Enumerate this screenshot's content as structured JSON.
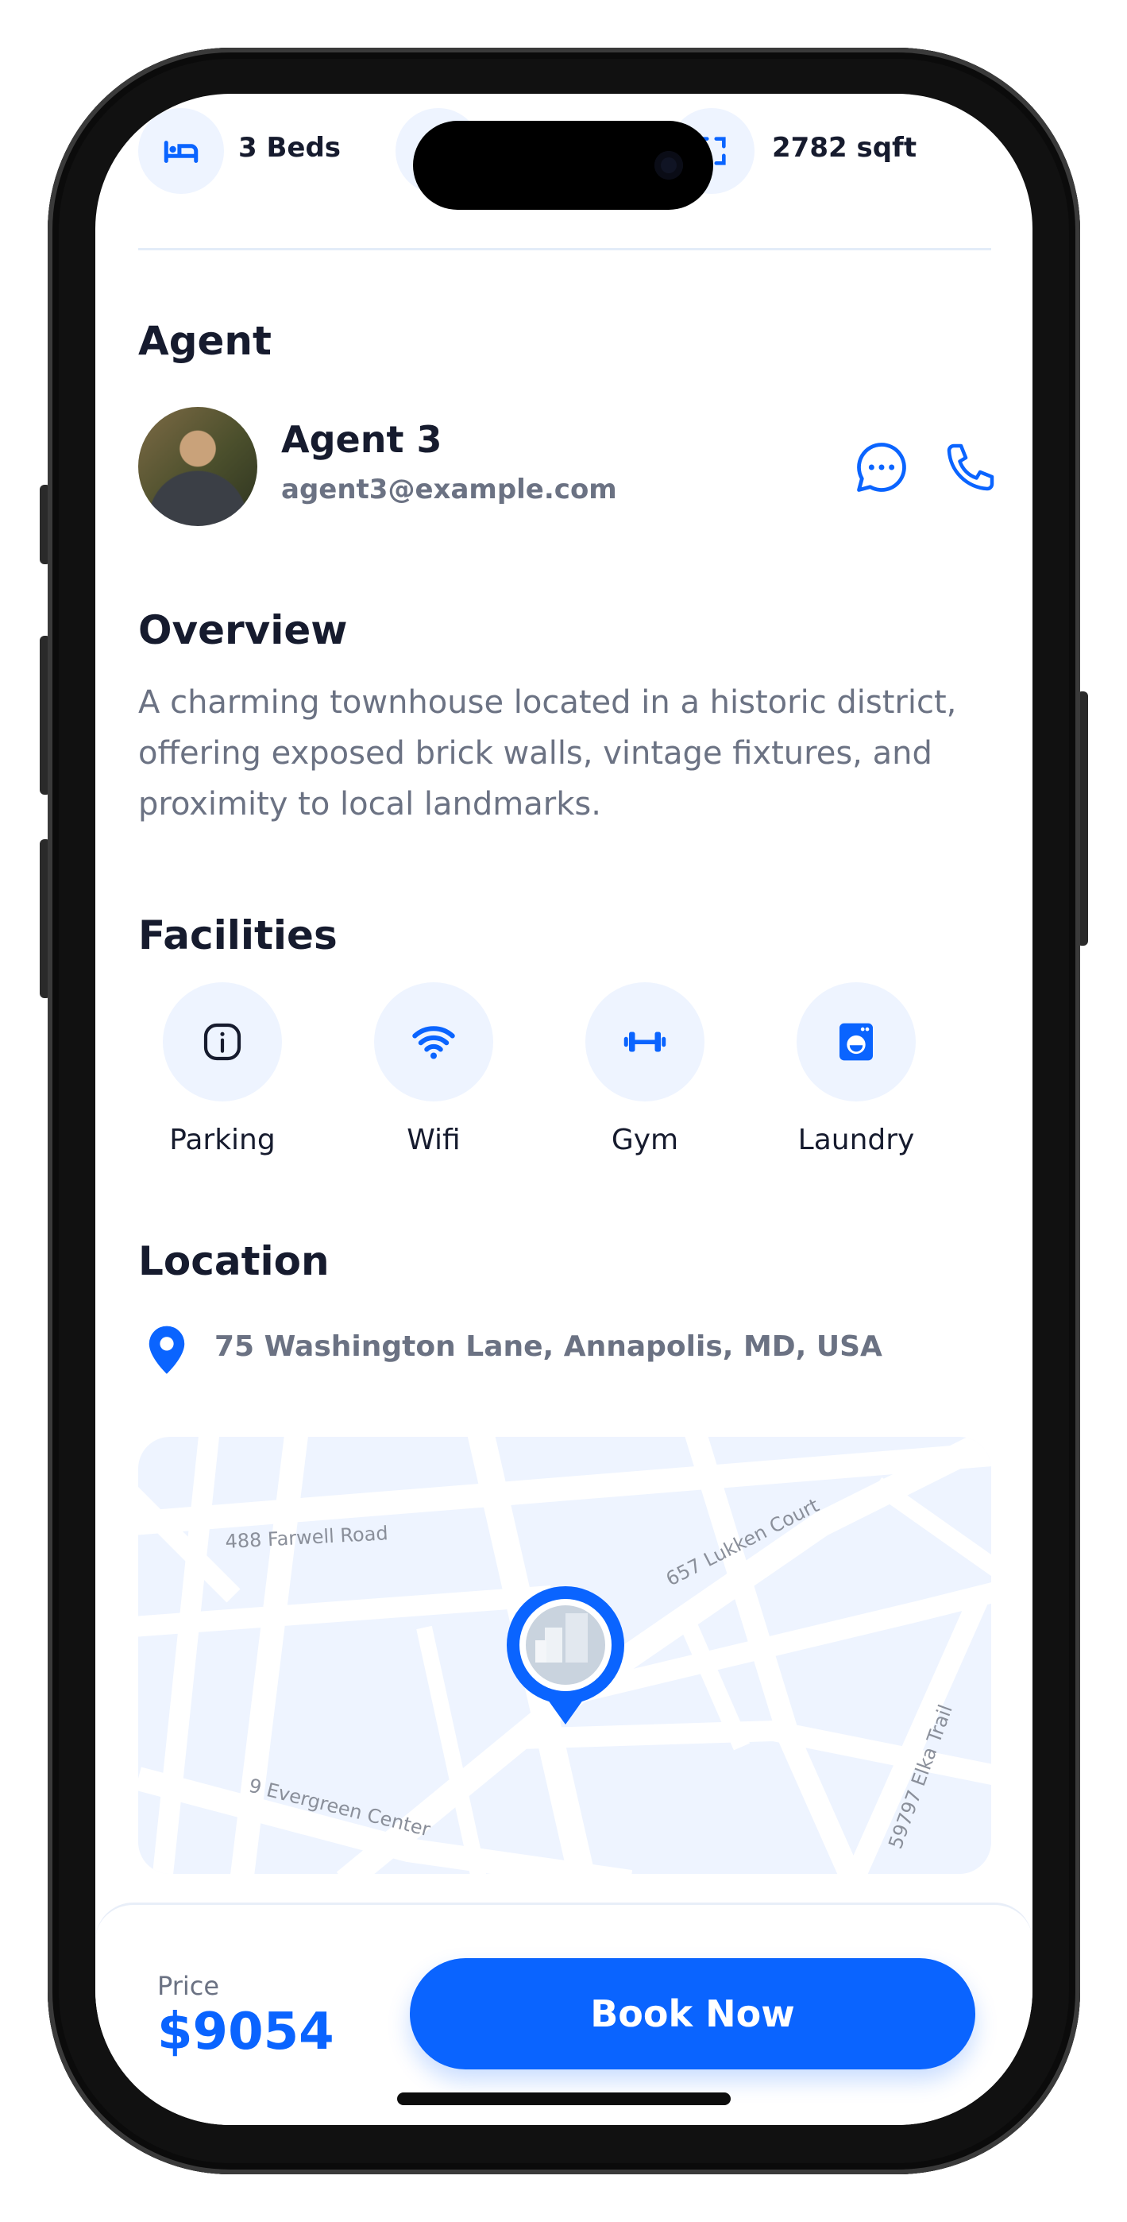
{
  "stats": {
    "beds": "3 Beds",
    "area": "2782 sqft"
  },
  "agent": {
    "section_title": "Agent",
    "name": "Agent 3",
    "email": "agent3@example.com"
  },
  "overview": {
    "section_title": "Overview",
    "text": "A charming townhouse located in a historic district, offering exposed brick walls, vintage fixtures, and proximity to local landmarks."
  },
  "facilities": {
    "section_title": "Facilities",
    "items": [
      {
        "label": "Parking",
        "icon": "info-icon"
      },
      {
        "label": "Wifi",
        "icon": "wifi-icon"
      },
      {
        "label": "Gym",
        "icon": "dumbbell-icon"
      },
      {
        "label": "Laundry",
        "icon": "washing-machine-icon"
      }
    ]
  },
  "location": {
    "section_title": "Location",
    "address": "75 Washington Lane, Annapolis, MD, USA",
    "map_streets": [
      "488 Farwell Road",
      "657 Lukken Court",
      "9 Evergreen Center",
      "59797 Elka Trail"
    ]
  },
  "footer": {
    "price_label": "Price",
    "price": "$9054",
    "book_label": "Book Now"
  },
  "colors": {
    "accent": "#0a64ff",
    "text_dark": "#161b2e",
    "text_muted": "#6b7283",
    "icon_bg": "#eef4ff"
  }
}
